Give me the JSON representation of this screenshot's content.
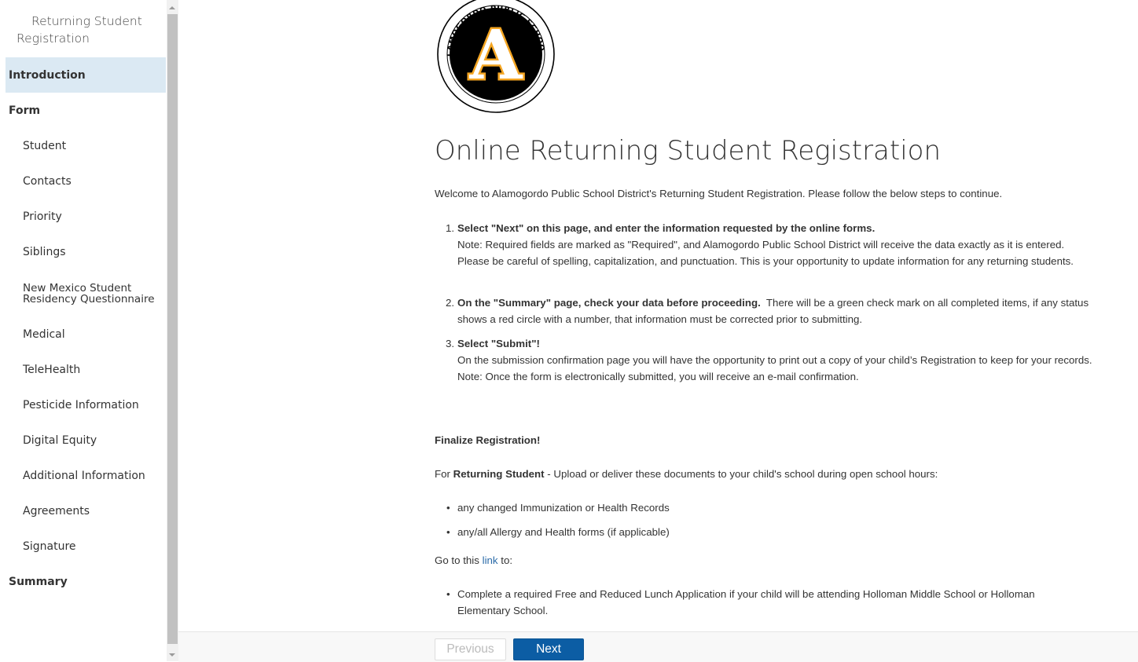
{
  "sidebar": {
    "title_line1": "Returning Student",
    "title_line2": "Registration",
    "items": [
      {
        "label": "Introduction"
      },
      {
        "label": "Form"
      },
      {
        "label": "Student"
      },
      {
        "label": "Contacts"
      },
      {
        "label": "Priority"
      },
      {
        "label": "Siblings"
      },
      {
        "label_line1": "New Mexico Student",
        "label_line2": "Residency Questionnaire"
      },
      {
        "label": "Medical"
      },
      {
        "label": "TeleHealth"
      },
      {
        "label": "Pesticide Information"
      },
      {
        "label": "Digital Equity"
      },
      {
        "label": "Additional Information"
      },
      {
        "label": "Agreements"
      },
      {
        "label": "Signature"
      },
      {
        "label": "Summary"
      }
    ]
  },
  "logo": {
    "top_text": "ALAMOGORDO PUBLIC SCHOOLS",
    "letter": "A",
    "bottom_text": "ESTABLISHED IN 1898"
  },
  "main": {
    "title": "Online Returning Student Registration",
    "welcome": "Welcome to Alamogordo Public School District's Returning Student Registration. Please follow the below steps to continue.",
    "steps": [
      {
        "num": "1.",
        "heading": "Select \"Next\" on this page, and enter the information requested by the online forms.",
        "text": "Note: Required fields are marked as \"Required\", and Alamogordo Public School District will receive the data exactly as it is entered.  Please be careful of spelling, capitalization, and punctuation. This is your opportunity to update information for any returning students."
      },
      {
        "num": "2.",
        "heading": "On the \"Summary\" page, check your data before proceeding.",
        "text": "There will be a green check mark on all completed items, if any status shows a red circle with a number, that information must be corrected prior to submitting."
      },
      {
        "num": "3.",
        "heading": "Select \"Submit\"!",
        "text": "On the submission confirmation page you will have the opportunity to print out a copy of your child’s Registration to keep for your records.  Note:  Once the form is electronically submitted, you will receive an e-mail confirmation."
      }
    ],
    "finalize": "Finalize Registration!",
    "for_prefix": "For ",
    "for_bold": "Returning Student",
    "for_suffix": " - Upload or deliver these documents to your child's school during open school hours:",
    "documents": [
      "any changed Immunization or Health Records",
      "any/all Allergy and Health forms (if applicable)"
    ],
    "goto_prefix": "Go to this ",
    "goto_link": "link",
    "goto_suffix": " to:",
    "link_items": [
      "Complete a required Free and Reduced Lunch Application if your child will be attending Holloman Middle School or Holloman Elementary School."
    ]
  },
  "footer": {
    "previous_label": "Previous",
    "next_label": "Next"
  },
  "colors": {
    "accent": "#0c5da4",
    "active_nav": "#dbe9f3",
    "logo_gold": "#f5a623"
  }
}
